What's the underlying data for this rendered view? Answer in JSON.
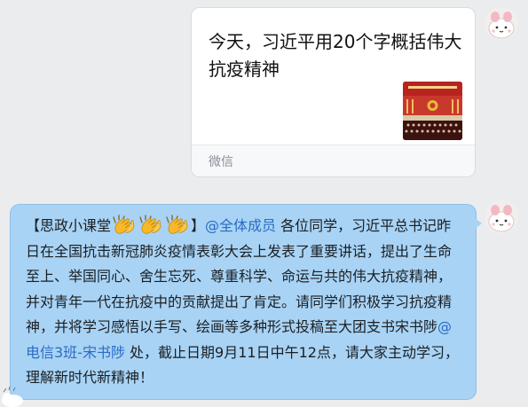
{
  "shared_card": {
    "title": "今天，习近平用20个字概括伟大抗疫精神",
    "source": "微信"
  },
  "message": {
    "prefix": "【思政小课堂",
    "emoji_count": 3,
    "mention_all": "@全体成员",
    "body_1": " 各位同学，习近平总书记昨日在全国抗击新冠肺炎疫情表彰大会上发表了重要讲话，提出了生命至上、举国同心、舍生忘死、尊重科学、命运与共的伟大抗疫精神，并对青年一代在抗疫中的贡献提出了肯定。请同学们积极学习抗疫精神，并将学习感悟以手写、绘画等多种形式投稿至大团支书宋书陟",
    "mention_user": "@电信3班-宋书陟",
    "body_2": " 处，截止日期9月11日中午12点，请大家主动学习，理解新时代新精神！"
  },
  "colors": {
    "bubble": "#a8d3f5",
    "mention": "#2a6cc4",
    "background": "#eaecee"
  }
}
